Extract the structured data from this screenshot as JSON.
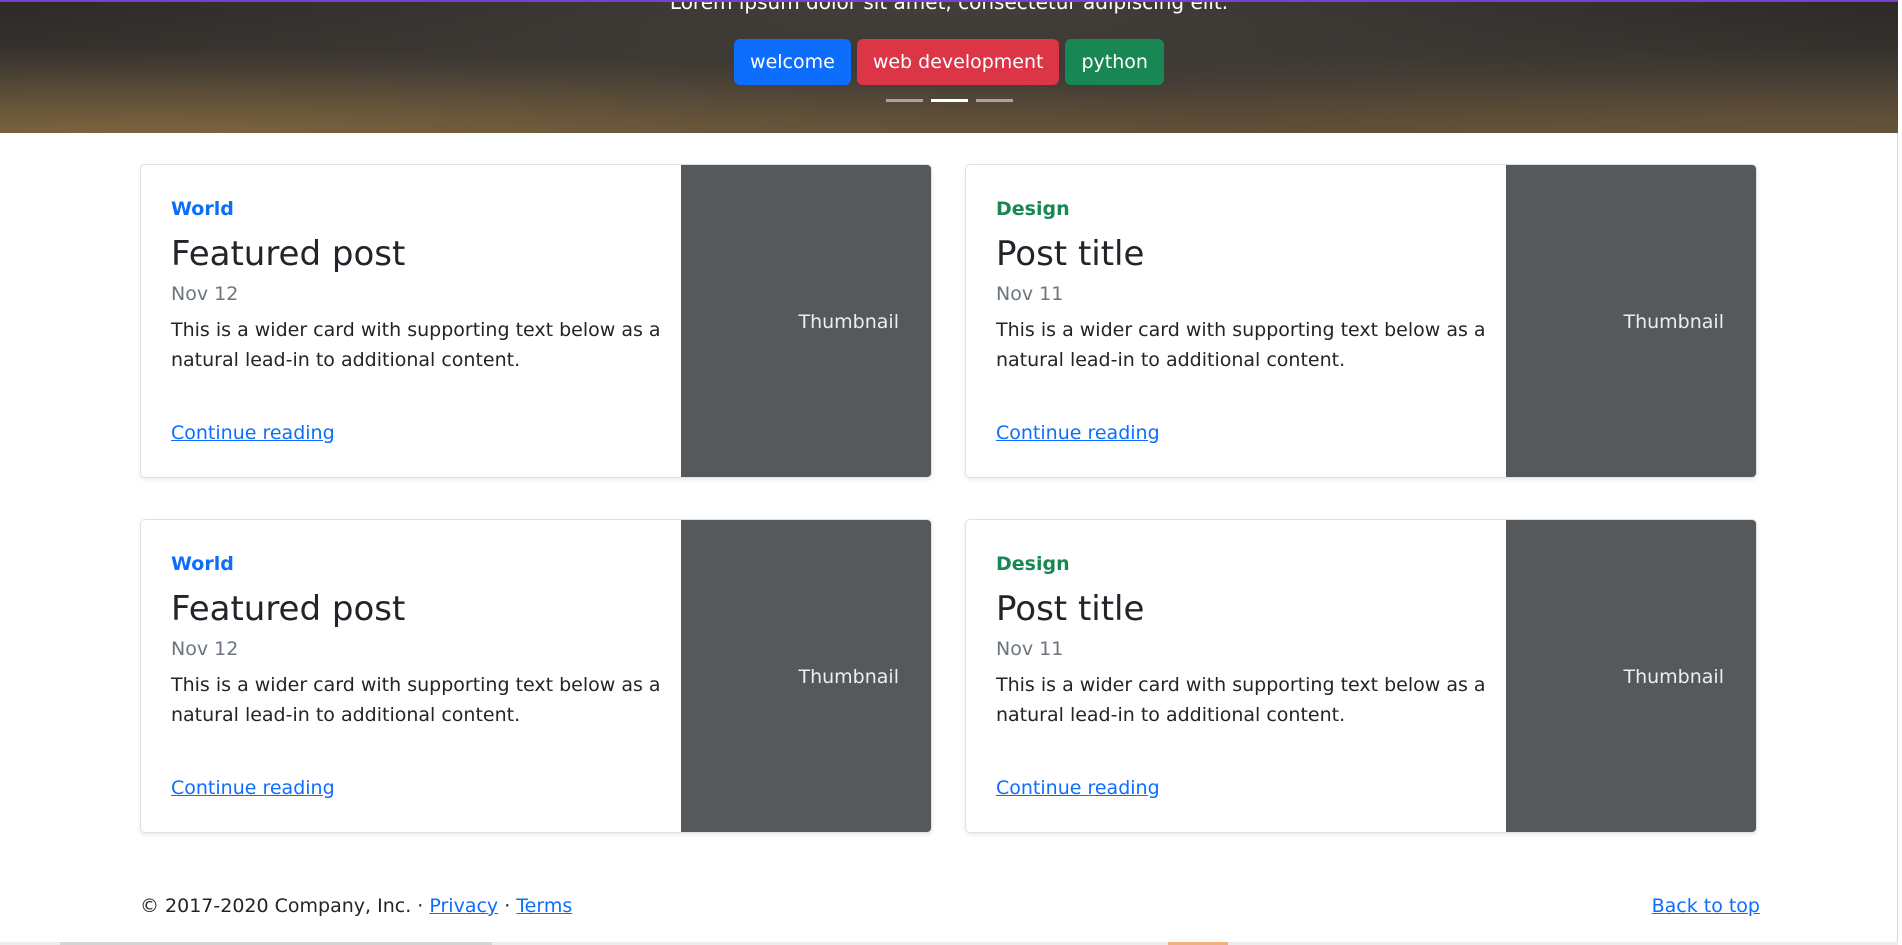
{
  "hero": {
    "caption": "Lorem ipsum dolor sit amet, consectetur adipiscing elit.",
    "tags": [
      {
        "label": "welcome",
        "color": "#0d6efd"
      },
      {
        "label": "web development",
        "color": "#dc3545"
      },
      {
        "label": "python",
        "color": "#198754"
      }
    ],
    "active_slide": 2,
    "slide_count": 3
  },
  "cards": [
    {
      "category": "World",
      "category_color": "#0d6efd",
      "title": "Featured post",
      "date": "Nov 12",
      "text": "This is a wider card with supporting text below as a natural lead-in to additional content.",
      "link": "Continue reading",
      "thumbnail": "Thumbnail"
    },
    {
      "category": "Design",
      "category_color": "#198754",
      "title": "Post title",
      "date": "Nov 11",
      "text": "This is a wider card with supporting text below as a natural lead-in to additional content.",
      "link": "Continue reading",
      "thumbnail": "Thumbnail"
    },
    {
      "category": "World",
      "category_color": "#0d6efd",
      "title": "Featured post",
      "date": "Nov 12",
      "text": "This is a wider card with supporting text below as a natural lead-in to additional content.",
      "link": "Continue reading",
      "thumbnail": "Thumbnail"
    },
    {
      "category": "Design",
      "category_color": "#198754",
      "title": "Post title",
      "date": "Nov 11",
      "text": "This is a wider card with supporting text below as a natural lead-in to additional content.",
      "link": "Continue reading",
      "thumbnail": "Thumbnail"
    }
  ],
  "footer": {
    "copyright": "© 2017-2020 Company, Inc. · ",
    "privacy": "Privacy",
    "separator": " · ",
    "terms": "Terms",
    "back_to_top": "Back to top"
  }
}
